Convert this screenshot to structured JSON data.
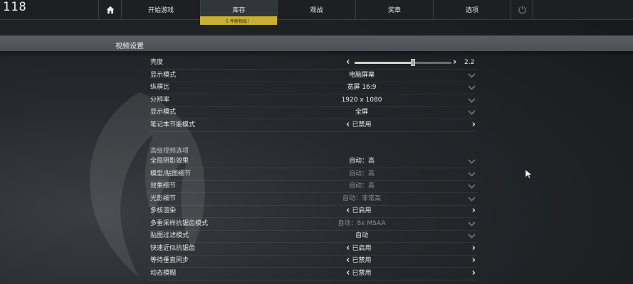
{
  "topbar": {
    "counter": "118",
    "nav": [
      "开始游戏",
      "库存",
      "观战",
      "奖章",
      "选项"
    ],
    "active_index": 1,
    "badge": "5 件新物品！"
  },
  "section_title": "视频设置",
  "settings": [
    {
      "label": "亮度",
      "type": "slider",
      "value": "2.2",
      "level": 0.6
    },
    {
      "label": "显示模式",
      "type": "dropdown",
      "value": "电脑屏幕"
    },
    {
      "label": "纵横比",
      "type": "dropdown",
      "value": "宽屏 16:9"
    },
    {
      "label": "分辨率",
      "type": "dropdown",
      "value": "1920 x 1080"
    },
    {
      "label": "显示模式",
      "type": "dropdown",
      "value": "全屏"
    },
    {
      "label": "笔记本节能模式",
      "type": "toggle",
      "value": "已禁用"
    }
  ],
  "advanced_title": "高级视频选项",
  "advanced": [
    {
      "label": "全局阴影效果",
      "type": "dropdown",
      "value": "自动：高"
    },
    {
      "label": "模型/贴图细节",
      "type": "dropdown",
      "value": "自动：高",
      "dim": true
    },
    {
      "label": "效果细节",
      "type": "dropdown",
      "value": "自动：高",
      "dim": true
    },
    {
      "label": "光影细节",
      "type": "dropdown",
      "value": "自动：非常高",
      "dim": true
    },
    {
      "label": "多核渲染",
      "type": "toggle",
      "value": "已启用"
    },
    {
      "label": "多重采样抗锯齿模式",
      "type": "dropdown",
      "value": "自动：8x MSAA",
      "dim": true
    },
    {
      "label": "贴图过滤模式",
      "type": "dropdown",
      "value": "自动"
    },
    {
      "label": "快速近似抗锯齿",
      "type": "toggle",
      "value": "已启用"
    },
    {
      "label": "等待垂直同步",
      "type": "toggle",
      "value": "已禁用"
    },
    {
      "label": "动态模糊",
      "type": "toggle",
      "value": "已禁用"
    }
  ],
  "icons": {
    "home": "home-icon",
    "power": "power-icon",
    "left": "chevron-left-icon",
    "right": "chevron-right-icon",
    "dropdown": "chevron-down-icon"
  },
  "colors": {
    "badge": "#c9b034",
    "topbar": "#1d1f22",
    "header_band": "#53575d"
  }
}
